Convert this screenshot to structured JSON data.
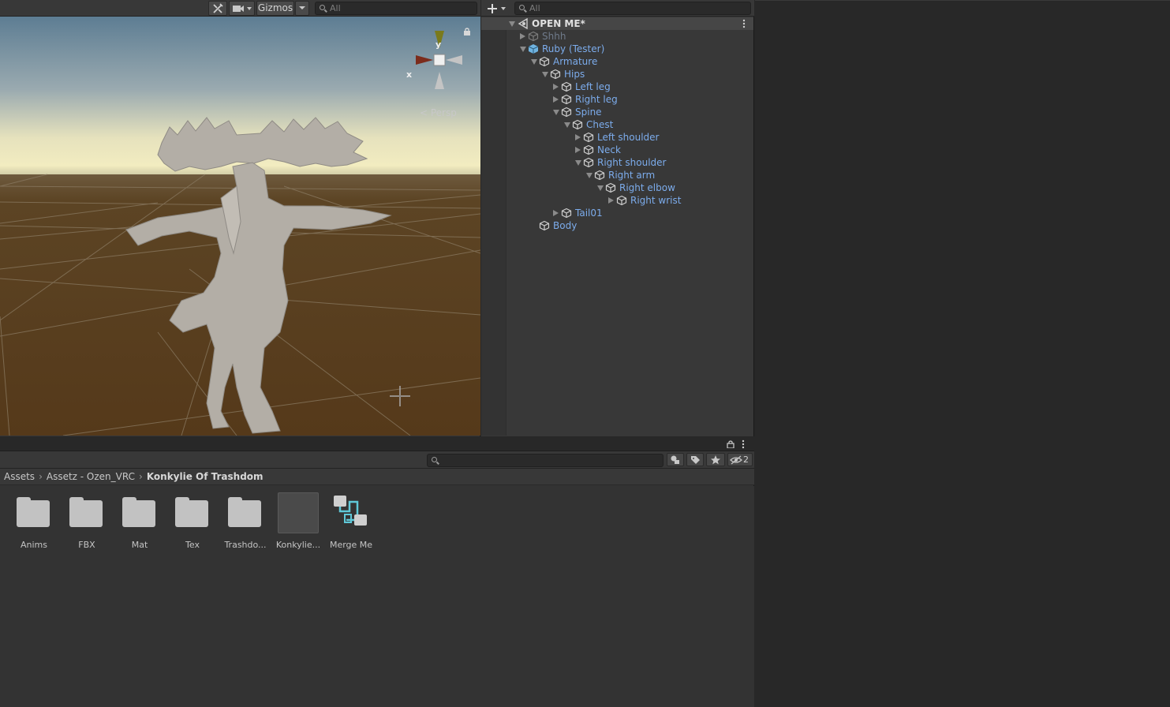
{
  "scene_view": {
    "toolbar": {
      "gizmos_label": "Gizmos",
      "search_placeholder": "All"
    },
    "axis_gizmo": {
      "y_label": "y",
      "x_label": "x"
    },
    "projection_label": "< Persp"
  },
  "hierarchy": {
    "search_placeholder": "All",
    "scene_name": "OPEN ME*",
    "items": [
      {
        "label": "Shhh",
        "depth": 1,
        "state": "collapsed",
        "inactive": true
      },
      {
        "label": "Ruby (Tester)",
        "depth": 1,
        "state": "expanded",
        "prefab": true
      },
      {
        "label": "Armature",
        "depth": 2,
        "state": "expanded"
      },
      {
        "label": "Hips",
        "depth": 3,
        "state": "expanded"
      },
      {
        "label": "Left leg",
        "depth": 4,
        "state": "collapsed"
      },
      {
        "label": "Right leg",
        "depth": 4,
        "state": "collapsed"
      },
      {
        "label": "Spine",
        "depth": 4,
        "state": "expanded"
      },
      {
        "label": "Chest",
        "depth": 5,
        "state": "expanded"
      },
      {
        "label": "Left shoulder",
        "depth": 6,
        "state": "collapsed"
      },
      {
        "label": "Neck",
        "depth": 6,
        "state": "collapsed"
      },
      {
        "label": "Right shoulder",
        "depth": 6,
        "state": "expanded"
      },
      {
        "label": "Right arm",
        "depth": 7,
        "state": "expanded"
      },
      {
        "label": "Right elbow",
        "depth": 8,
        "state": "expanded"
      },
      {
        "label": "Right wrist",
        "depth": 9,
        "state": "collapsed"
      },
      {
        "label": "Tail01",
        "depth": 4,
        "state": "collapsed"
      },
      {
        "label": "Body",
        "depth": 2,
        "state": "none"
      }
    ]
  },
  "project": {
    "hidden_count": "2",
    "breadcrumb": [
      "Assets",
      "Assetz - Ozen_VRC",
      "Konkylie Of Trashdom"
    ],
    "assets": [
      {
        "name": "Anims",
        "type": "folder"
      },
      {
        "name": "FBX",
        "type": "folder"
      },
      {
        "name": "Mat",
        "type": "folder"
      },
      {
        "name": "Tex",
        "type": "folder"
      },
      {
        "name": "Trashdo...",
        "type": "folder"
      },
      {
        "name": "Konkylie...",
        "type": "prefab"
      },
      {
        "name": "Merge Me",
        "type": "graph"
      }
    ]
  },
  "colors": {
    "hierarchy_label": "#7cacec",
    "scene_ground": "#5a3f1c",
    "sky_horizon": "#f2ecc0",
    "sky_top": "#5d7d93"
  }
}
